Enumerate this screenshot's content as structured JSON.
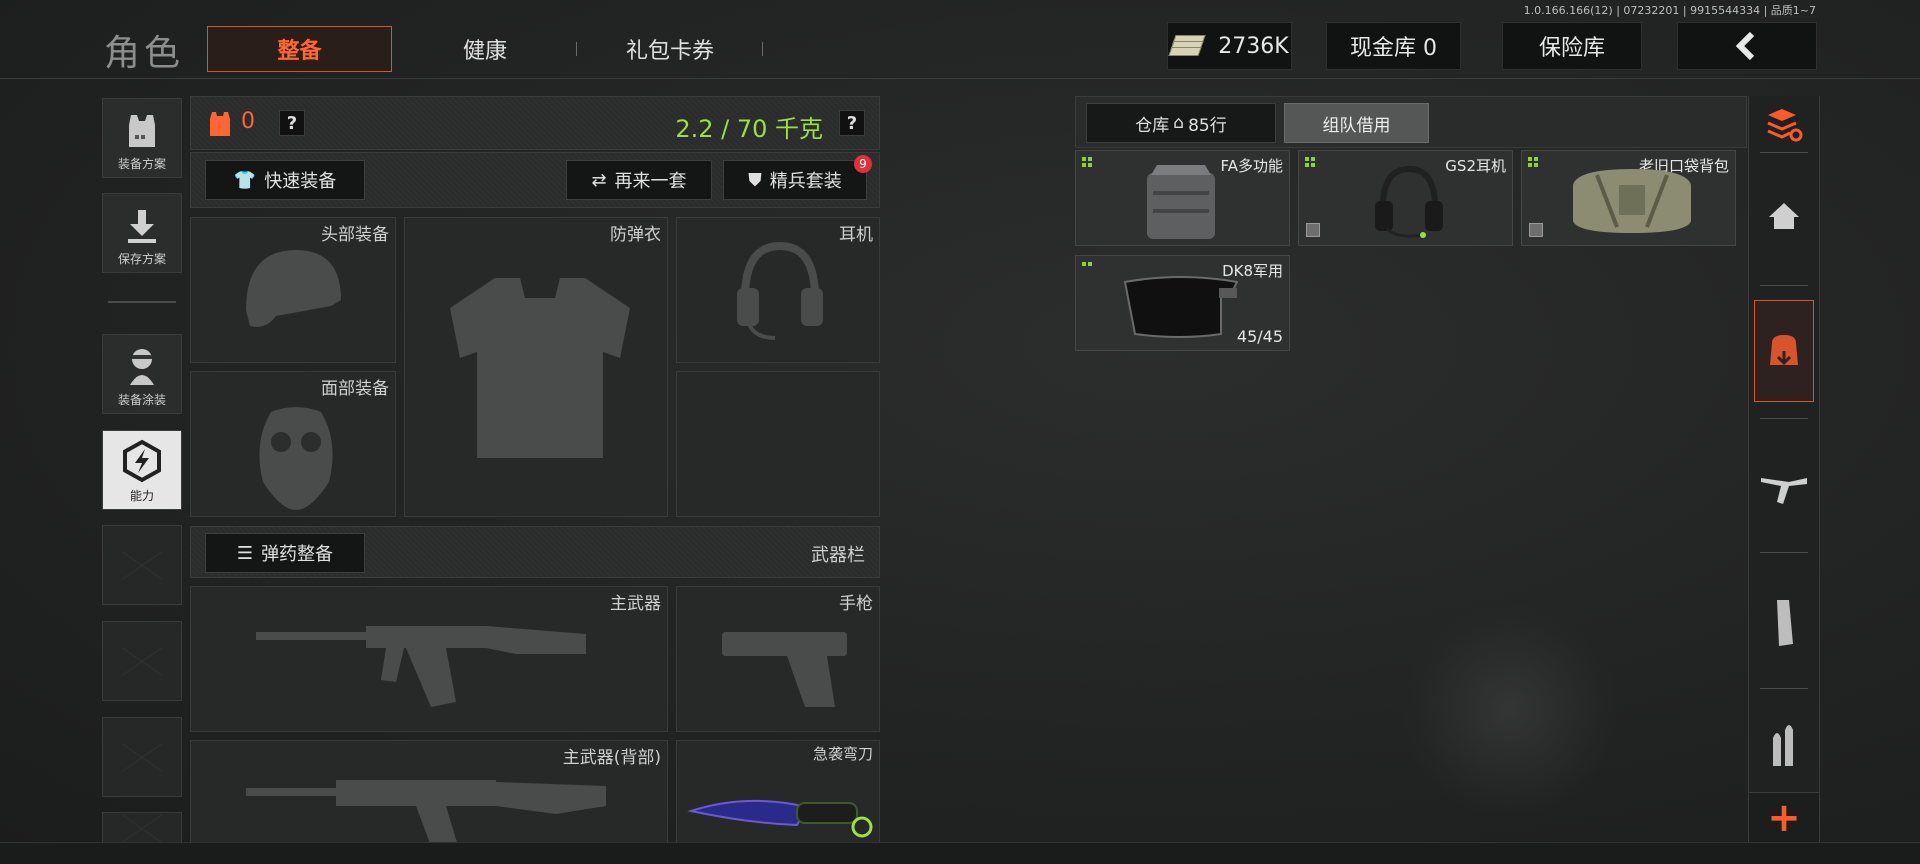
{
  "version": "1.0.166.166(12) | 07232201 | 9915544334 | 品质1~7",
  "header": {
    "role_title": "角色",
    "tabs": [
      {
        "label": "整备",
        "active": true
      },
      {
        "label": "健康",
        "active": false
      },
      {
        "label": "礼包卡券",
        "active": false
      }
    ],
    "money": "2736K",
    "cash_bank": "现金库 0",
    "vault": "保险库",
    "back_icon": "chevron-left-icon"
  },
  "left_sidebar": [
    {
      "label": "装备方案",
      "icon": "vest-icon"
    },
    {
      "label": "保存方案",
      "icon": "download-icon"
    },
    {
      "label": "装备涂装",
      "icon": "soldier-icon"
    },
    {
      "label": "能力",
      "icon": "hex-bolt-icon"
    }
  ],
  "loadout": {
    "armor_count": "0",
    "help": "?",
    "weight": "2.2 / 70 千克",
    "quick_equip": "快速装备",
    "again": "再来一套",
    "elite": "精兵套装",
    "elite_badge": "9",
    "slots": {
      "head": "头部装备",
      "vest": "防弹衣",
      "headset": "耳机",
      "face": "面部装备"
    },
    "ammo": "弹药整备",
    "weapon_bar": "武器栏",
    "weapons": {
      "primary": "主武器",
      "pistol": "手枪",
      "primary_back": "主武器(背部)",
      "knife": "急袭弯刀"
    }
  },
  "stash": {
    "tab_warehouse": "仓库",
    "tab_warehouse_rows": "85行",
    "tab_team": "组队借用",
    "items": [
      {
        "name": "FA多功能",
        "box": false
      },
      {
        "name": "GS2耳机",
        "box": true
      },
      {
        "name": "老旧口袋背包",
        "box": true
      },
      {
        "name": "DK8军用",
        "durability": "45/45",
        "box": false
      }
    ]
  },
  "right_sidebar": [
    "sort-icon",
    "home-icon",
    "backpack-icon",
    "rifle-icon",
    "magazine-icon",
    "ammo-icon",
    "plus-icon"
  ],
  "colors": {
    "accent": "#ff6633",
    "weight": "#9be044",
    "grade": "#8bd23b"
  }
}
